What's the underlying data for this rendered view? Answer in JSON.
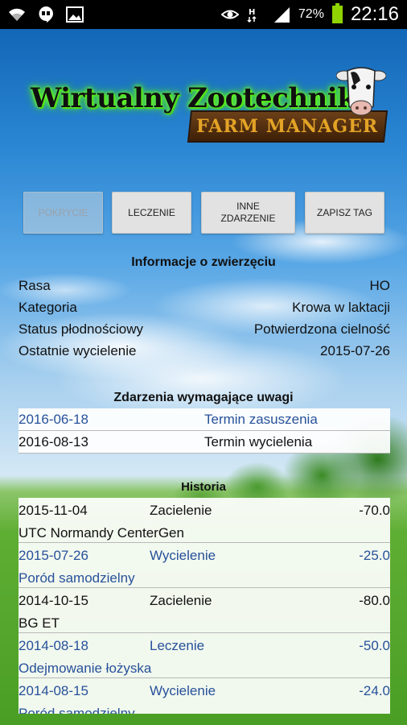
{
  "statusbar": {
    "icons_left": [
      "wifi-icon",
      "hangouts-icon",
      "image-icon"
    ],
    "icons_right": [
      "eye-icon",
      "hspa-icon",
      "signal-icon"
    ],
    "battery_percent": "72%",
    "time": "22:16"
  },
  "logo": {
    "title": "Wirtualny Zootechnik",
    "subtitle": "FARM MANAGER"
  },
  "buttons": {
    "pokrycie": "POKRYCIE",
    "leczenie": "LECZENIE",
    "inne_zdarzenie_line1": "INNE",
    "inne_zdarzenie_line2": "ZDARZENIE",
    "zapisz_tag": "ZAPISZ TAG"
  },
  "info": {
    "title": "Informacje o zwierzęciu",
    "rows": [
      {
        "label": "Rasa",
        "value": "HO"
      },
      {
        "label": "Kategoria",
        "value": "Krowa w laktacji"
      },
      {
        "label": "Status płodnościowy",
        "value": "Potwierdzona cielność"
      },
      {
        "label": "Ostatnie wycielenie",
        "value": "2015-07-26"
      }
    ]
  },
  "events": {
    "title": "Zdarzenia wymagające uwagi",
    "rows": [
      {
        "date": "2016-06-18",
        "name": "Termin zasuszenia"
      },
      {
        "date": "2016-08-13",
        "name": "Termin wycielenia"
      }
    ]
  },
  "history": {
    "title": "Historia",
    "items": [
      {
        "date": "2015-11-04",
        "type": "Zacielenie",
        "amount": "-70.0",
        "desc": "UTC Normandy CenterGen"
      },
      {
        "date": "2015-07-26",
        "type": "Wycielenie",
        "amount": "-25.0",
        "desc": "Poród samodzielny"
      },
      {
        "date": "2014-10-15",
        "type": "Zacielenie",
        "amount": "-80.0",
        "desc": "BG ET"
      },
      {
        "date": "2014-08-18",
        "type": "Leczenie",
        "amount": "-50.0",
        "desc": "Odejmowanie łożyska"
      },
      {
        "date": "2014-08-15",
        "type": "Wycielenie",
        "amount": "-24.0",
        "desc": "Poród samodzielny"
      }
    ]
  },
  "colors": {
    "row_blue": "#27519a",
    "row_black": "#111111",
    "logo_glow": "#6aff2a",
    "banner_text": "#e3a326"
  }
}
